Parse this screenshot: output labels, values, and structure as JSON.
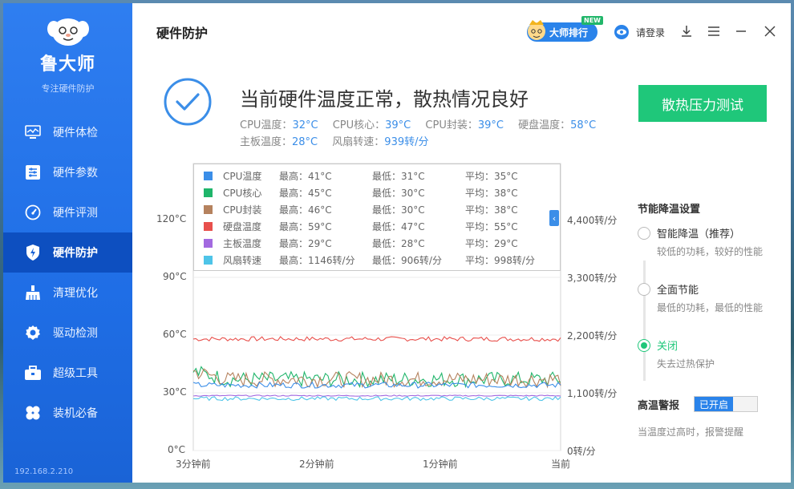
{
  "app": {
    "name": "鲁大师",
    "tagline": "专注硬件防护",
    "footer": "192.168.2.210"
  },
  "sidebar": {
    "items": [
      {
        "label": "硬件体检",
        "icon": "monitor-icon"
      },
      {
        "label": "硬件参数",
        "icon": "sliders-icon"
      },
      {
        "label": "硬件评测",
        "icon": "speedometer-icon"
      },
      {
        "label": "硬件防护",
        "icon": "shield-bolt-icon",
        "active": true
      },
      {
        "label": "清理优化",
        "icon": "broom-icon"
      },
      {
        "label": "驱动检测",
        "icon": "gear-icon"
      },
      {
        "label": "超级工具",
        "icon": "toolbox-icon"
      },
      {
        "label": "装机必备",
        "icon": "clover-icon"
      }
    ]
  },
  "header": {
    "title": "硬件防护",
    "rank_label": "大师排行",
    "new_badge": "NEW",
    "login_label": "请登录"
  },
  "status": {
    "title": "当前硬件温度正常，散热情况良好",
    "readings": [
      {
        "label": "CPU温度：",
        "value": "32°C"
      },
      {
        "label": "CPU核心：",
        "value": "39°C"
      },
      {
        "label": "CPU封装：",
        "value": "39°C"
      },
      {
        "label": "硬盘温度：",
        "value": "58°C"
      },
      {
        "label": "主板温度：",
        "value": "28°C"
      },
      {
        "label": "风扇转速：",
        "value": "939转/分"
      }
    ],
    "stress_button": "散热压力测试"
  },
  "legend": [
    {
      "name": "CPU温度",
      "max": "最高：41°C",
      "min": "最低：31°C",
      "avg": "平均：35°C",
      "color": "#3b8ee8"
    },
    {
      "name": "CPU核心",
      "max": "最高：45°C",
      "min": "最低：30°C",
      "avg": "平均：38°C",
      "color": "#1fb56a"
    },
    {
      "name": "CPU封装",
      "max": "最高：46°C",
      "min": "最低：30°C",
      "avg": "平均：38°C",
      "color": "#b5825e"
    },
    {
      "name": "硬盘温度",
      "max": "最高：59°C",
      "min": "最低：47°C",
      "avg": "平均：55°C",
      "color": "#e8504c"
    },
    {
      "name": "主板温度",
      "max": "最高：29°C",
      "min": "最低：28°C",
      "avg": "平均：29°C",
      "color": "#a36ae0"
    },
    {
      "name": "风扇转速",
      "max": "最高：1146转/分",
      "min": "最低：906转/分",
      "avg": "平均：998转/分",
      "color": "#4ec4e8"
    }
  ],
  "chart_data": {
    "type": "line",
    "y_left_ticks": [
      "120°C",
      "90°C",
      "60°C",
      "30°C",
      "0°C"
    ],
    "y_right_ticks": [
      "4,400转/分",
      "3,300转/分",
      "2,200转/分",
      "1,100转/分",
      "0转/分"
    ],
    "x_ticks": [
      "3分钟前",
      "2分钟前",
      "1分钟前",
      "当前"
    ],
    "ylim_left": [
      0,
      120
    ],
    "ylim_right": [
      0,
      4400
    ],
    "series": [
      {
        "name": "硬盘温度",
        "color": "#e8504c",
        "base": 58,
        "noise": 1.2
      },
      {
        "name": "CPU核心",
        "color": "#1fb56a",
        "base": 37,
        "noise": 4
      },
      {
        "name": "CPU封装",
        "color": "#b5825e",
        "base": 37,
        "noise": 4
      },
      {
        "name": "CPU温度",
        "color": "#3b8ee8",
        "base": 34,
        "noise": 1.5
      },
      {
        "name": "主板温度",
        "color": "#a36ae0",
        "base": 28.5,
        "noise": 0.3
      },
      {
        "name": "风扇转速",
        "color": "#4ec4e8",
        "base": 27,
        "noise": 1.0
      }
    ]
  },
  "energy": {
    "title": "节能降温设置",
    "options": [
      {
        "name": "智能降温（推荐）",
        "desc": "较低的功耗，较好的性能",
        "selected": false
      },
      {
        "name": "全面节能",
        "desc": "最低的功耗，最低的性能",
        "selected": false
      },
      {
        "name": "关闭",
        "desc": "失去过热保护",
        "selected": true
      }
    ]
  },
  "alarm": {
    "title": "高温警报",
    "toggle_on": "已开启",
    "desc": "当温度过高时，报警提醒"
  }
}
